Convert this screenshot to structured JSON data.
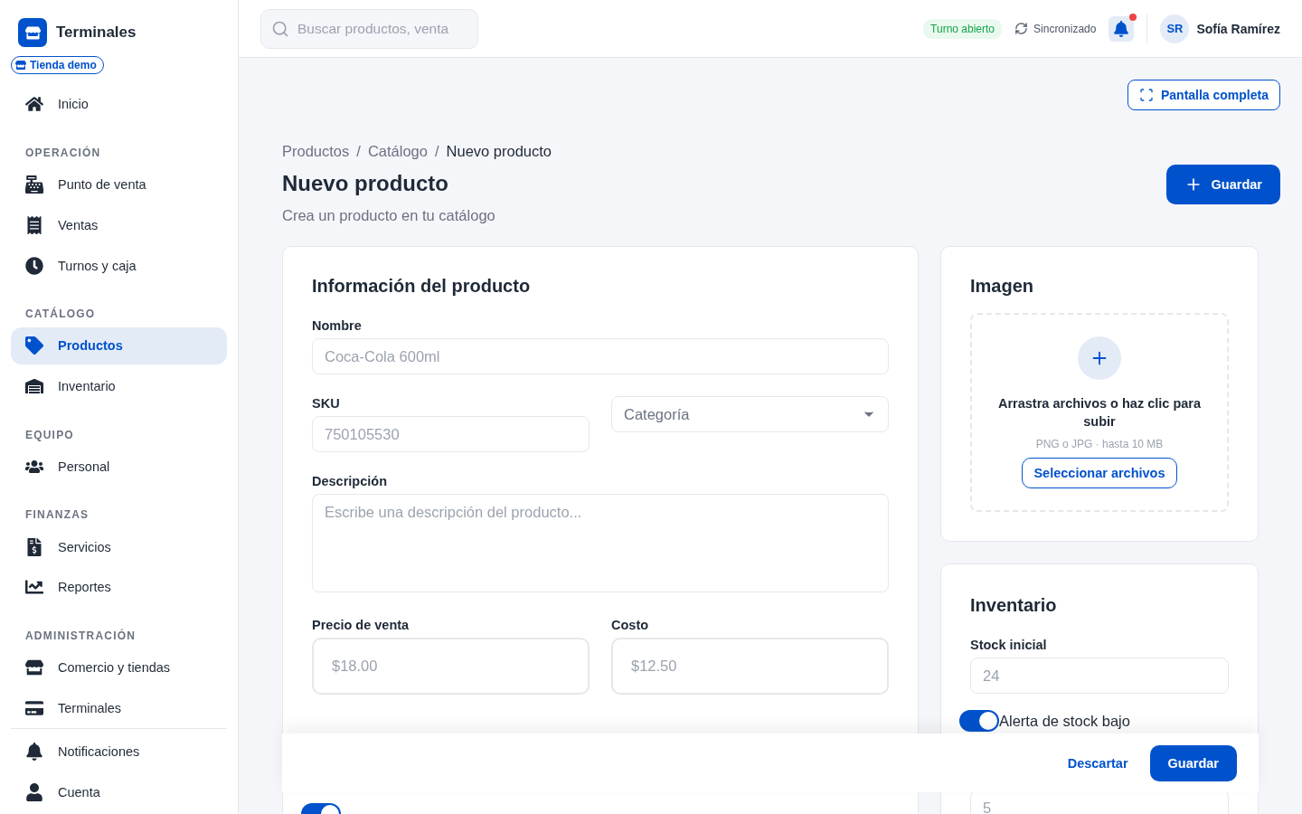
{
  "sidebar": {
    "brand": "Terminales",
    "store_badge": "Tienda demo",
    "groups": [
      {
        "items": [
          {
            "label": "Inicio",
            "selected": false
          }
        ]
      },
      {
        "heading": "OPERACIÓN",
        "items": [
          {
            "label": "Punto de venta",
            "selected": false
          },
          {
            "label": "Ventas",
            "selected": false
          },
          {
            "label": "Turnos y caja",
            "selected": false
          }
        ]
      },
      {
        "heading": "CATÁLOGO",
        "items": [
          {
            "label": "Productos",
            "selected": true
          },
          {
            "label": "Inventario",
            "selected": false
          }
        ]
      },
      {
        "heading": "EQUIPO",
        "items": [
          {
            "label": "Personal",
            "selected": false
          }
        ]
      },
      {
        "heading": "FINANZAS",
        "items": [
          {
            "label": "Servicios",
            "selected": false
          },
          {
            "label": "Reportes",
            "selected": false
          }
        ]
      },
      {
        "heading": "ADMINISTRACIÓN",
        "items": [
          {
            "label": "Comercio y tiendas",
            "selected": false
          },
          {
            "label": "Terminales",
            "selected": false
          }
        ]
      }
    ],
    "footer_items": [
      {
        "label": "Notificaciones",
        "selected": false
      },
      {
        "label": "Cuenta",
        "selected": false
      }
    ]
  },
  "topbar": {
    "search": {
      "placeholder": "Buscar productos, venta"
    },
    "shift_badge": "Turno abierto",
    "sync_status": "Sincronizado",
    "notifications_unread": true,
    "user": {
      "initials": "SR",
      "name": "Sofía Ramírez"
    }
  },
  "fullscreen_button": "Pantalla completa",
  "breadcrumb": [
    {
      "kind": "link",
      "text": "Productos"
    },
    {
      "kind": "separator",
      "text": "/"
    },
    {
      "kind": "link",
      "text": "Catálogo"
    },
    {
      "kind": "separator",
      "text": "/"
    },
    {
      "kind": "current",
      "text": "Nuevo producto"
    }
  ],
  "page": {
    "title": "Nuevo producto",
    "subtitle": "Crea un producto en tu catálogo",
    "save_button": "Guardar"
  },
  "product_card": {
    "title": "Información del producto",
    "name": {
      "label": "Nombre",
      "placeholder": "Coca-Cola 600ml"
    },
    "sku": {
      "label": "SKU",
      "placeholder": "750105530"
    },
    "category": {
      "placeholder": "Categoría"
    },
    "description": {
      "label": "Descripción",
      "placeholder": "Escribe una descripción del producto..."
    },
    "price": {
      "label": "Precio de venta",
      "placeholder": "$18.00"
    },
    "cost": {
      "label": "Costo",
      "placeholder": "$12.50"
    },
    "bottom_toggle": {
      "on": true
    }
  },
  "image_card": {
    "title": "Imagen",
    "drop_text": "Arrastra archivos o haz clic para subir",
    "hint": "PNG o JPG · hasta 10 MB",
    "select_button": "Seleccionar archivos"
  },
  "inventory_card": {
    "title": "Inventario",
    "stock": {
      "label": "Stock inicial",
      "placeholder": "24"
    },
    "low_stock_alert": {
      "label": "Alerta de stock bajo",
      "on": true
    },
    "threshold": {
      "placeholder": "5"
    }
  },
  "action_bar": {
    "discard": "Descartar",
    "save": "Guardar"
  }
}
